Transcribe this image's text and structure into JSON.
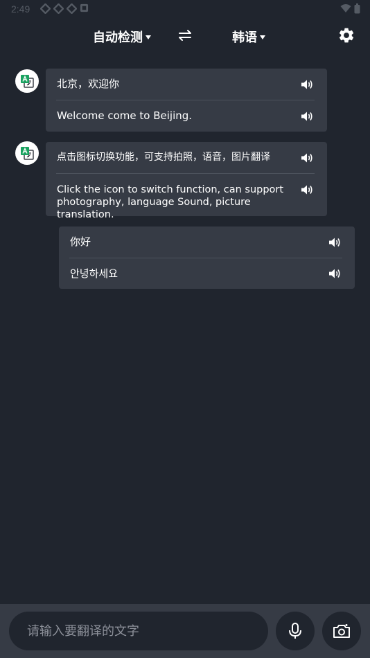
{
  "status_bar": {
    "time": "2:49"
  },
  "header": {
    "source_language": "自动检测",
    "target_language": "韩语"
  },
  "messages": [
    {
      "kind": "incoming",
      "source_text": "北京，欢迎你",
      "translated_text": "Welcome come to Beijing."
    },
    {
      "kind": "incoming",
      "source_text": "点击图标切换功能，可支持拍照，语音，图片翻译",
      "translated_text": "Click the icon to switch function, can support photography, language Sound, picture translation."
    },
    {
      "kind": "outgoing",
      "source_text": "你好",
      "translated_text": "안녕하세요"
    }
  ],
  "input_bar": {
    "placeholder": "请输入要翻译的文字"
  },
  "colors": {
    "background": "#20252e",
    "card": "#363b45",
    "avatar_icon_accent": "#1aa260"
  }
}
